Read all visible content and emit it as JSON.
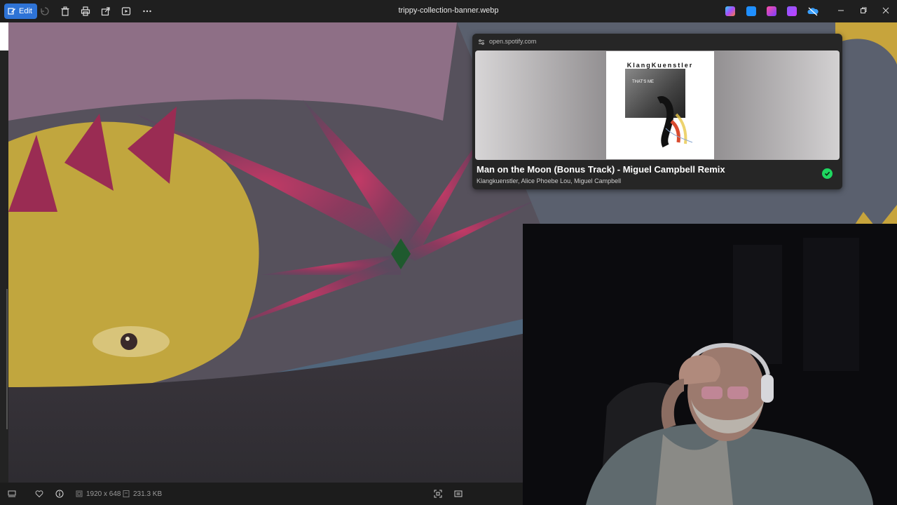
{
  "window": {
    "title": "trippy-collection-banner.webp"
  },
  "toolbar": {
    "edit_label": "Edit",
    "icons": [
      "edit-icon",
      "rotate-icon",
      "delete-icon",
      "print-icon",
      "share-icon",
      "slideshow-icon",
      "more-icon"
    ]
  },
  "taskbar_apps": [
    "copilot-icon",
    "app-blue-icon",
    "app-purple-icon",
    "app-violet-icon",
    "onedrive-icon"
  ],
  "status": {
    "dimensions": "1920 x 648",
    "file_size": "231.3 KB"
  },
  "toast": {
    "host": "open.spotify.com",
    "album_brand": "KlangKuenstler",
    "album_subtitle": "THAT'S ME",
    "track_title": "Man on the Moon (Bonus Track) - Miguel Campbell Remix",
    "artists": "Klangkuenstler, Alice Phoebe Lou, Miguel Campbell",
    "accent": "#1ed760"
  },
  "colors": {
    "edit_accent": "#2e73d6",
    "toolbar_bg": "#1f1f1f"
  }
}
